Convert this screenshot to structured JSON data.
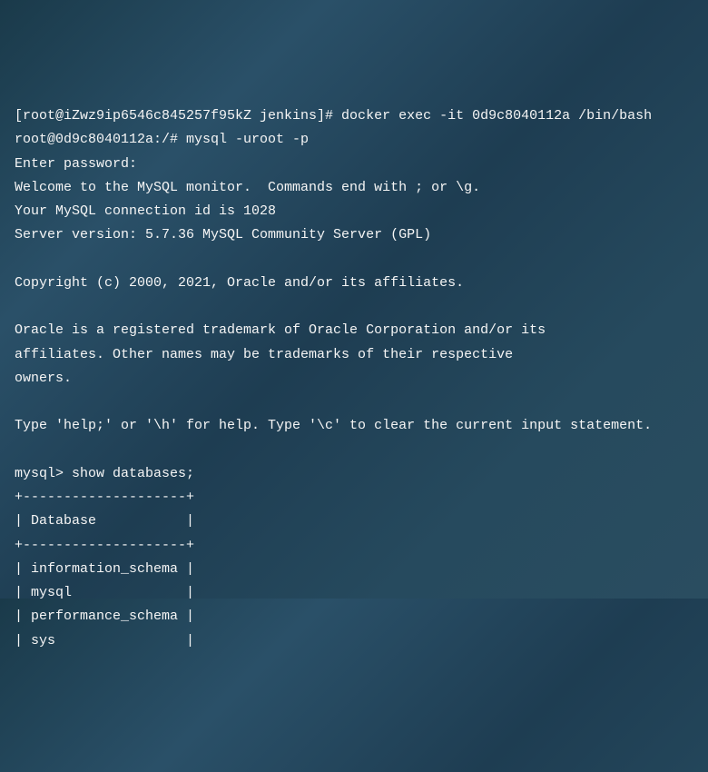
{
  "lines": {
    "l1": "[root@iZwz9ip6546c845257f95kZ jenkins]# docker exec -it 0d9c8040112a /bin/bash",
    "l2": "root@0d9c8040112a:/# mysql -uroot -p",
    "l3": "Enter password:",
    "l4": "Welcome to the MySQL monitor.  Commands end with ; or \\g.",
    "l5": "Your MySQL connection id is 1028",
    "l6": "Server version: 5.7.36 MySQL Community Server (GPL)",
    "l7": "",
    "l8": "Copyright (c) 2000, 2021, Oracle and/or its affiliates.",
    "l9": "",
    "l10": "Oracle is a registered trademark of Oracle Corporation and/or its",
    "l11": "affiliates. Other names may be trademarks of their respective",
    "l12": "owners.",
    "l13": "",
    "l14": "Type 'help;' or '\\h' for help. Type '\\c' to clear the current input statement.",
    "l15": "",
    "l16": "mysql> show databases;",
    "l17": "+--------------------+",
    "l18": "| Database           |",
    "l19": "+--------------------+",
    "l20": "| information_schema |",
    "l21": "| mysql              |",
    "l22": "| performance_schema |",
    "l23": "| sys                |"
  }
}
